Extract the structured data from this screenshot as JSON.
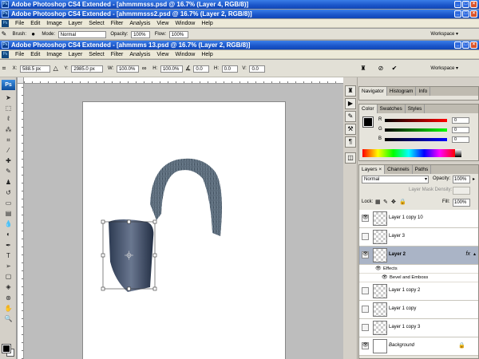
{
  "windows": [
    {
      "title": "Adobe Photoshop CS4 Extended - [ahmmmsss.psd @ 16.7% (Layer 4, RGB/8)]"
    },
    {
      "title": "Adobe Photoshop CS4 Extended - [ahmmmsss2.psd @ 16.7% (Layer 2, RGB/8)]"
    },
    {
      "title": "Adobe Photoshop CS4 Extended - [ahmmms 13.psd @ 16.7% (Layer 2, RGB/8)]"
    }
  ],
  "menu": [
    "File",
    "Edit",
    "Image",
    "Layer",
    "Select",
    "Filter",
    "Analysis",
    "View",
    "Window",
    "Help"
  ],
  "brush_options": {
    "brush_label": "Brush:",
    "mode_label": "Mode:",
    "mode_value": "Normal",
    "opacity_label": "Opacity:",
    "opacity_value": "100%",
    "flow_label": "Flow:",
    "flow_value": "100%",
    "workspace": "Workspace"
  },
  "transform_options": {
    "x_label": "X:",
    "x_value": "588.5 px",
    "y_label": "Y:",
    "y_value": "2985.0 px",
    "w_label": "W:",
    "w_value": "100.0%",
    "h_label": "H:",
    "h_value": "100.0%",
    "angle_value": "0.0",
    "hskew_label": "H:",
    "hskew_value": "0.0",
    "vskew_label": "V:",
    "vskew_value": "0.0",
    "workspace": "Workspace"
  },
  "navigator_tabs": [
    "Navigator",
    "Histogram",
    "Info"
  ],
  "color_tabs": [
    "Color",
    "Swatches",
    "Styles"
  ],
  "color": {
    "channels": [
      {
        "name": "R",
        "value": "0"
      },
      {
        "name": "G",
        "value": "0"
      },
      {
        "name": "B",
        "value": "0"
      }
    ]
  },
  "layers_tabs": [
    "Layers",
    "Channels",
    "Paths"
  ],
  "layers_panel": {
    "blend_mode": "Normal",
    "opacity_label": "Opacity:",
    "opacity_value": "100%",
    "density_label": "Layer Mask Density:",
    "lock_label": "Lock:",
    "fill_label": "Fill:",
    "fill_value": "100%",
    "fx_badge": "fx",
    "layers": [
      {
        "name": "Layer 1 copy 10"
      },
      {
        "name": "Layer 3"
      },
      {
        "name": "Layer 2"
      },
      {
        "name": "Layer 1 copy 2"
      },
      {
        "name": "Layer 1 copy"
      },
      {
        "name": "Layer 1 copy 3"
      },
      {
        "name": "Background"
      }
    ],
    "effects_label": "Effects",
    "effect_name": "Bevel and Emboss"
  }
}
